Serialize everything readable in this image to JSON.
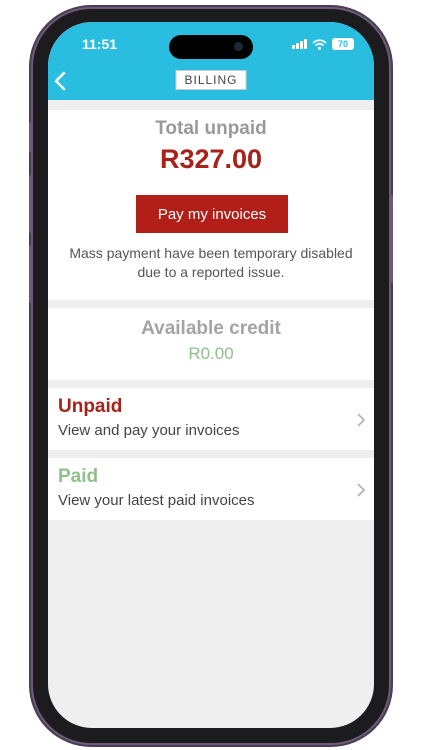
{
  "status_bar": {
    "time": "11:51",
    "battery": "70"
  },
  "header": {
    "title": "BILLING"
  },
  "summary": {
    "total_label": "Total unpaid",
    "total_amount": "R327.00",
    "pay_button": "Pay my invoices",
    "notice": "Mass payment have been temporary disabled due to a reported issue."
  },
  "credit": {
    "label": "Available credit",
    "amount": "R0.00"
  },
  "rows": [
    {
      "title": "Unpaid",
      "subtitle": "View and pay your invoices",
      "color": "#a72319"
    },
    {
      "title": "Paid",
      "subtitle": "View your latest paid invoices",
      "color": "#8fbf8a"
    }
  ],
  "colors": {
    "header_bg": "#29bedf",
    "accent_red": "#b21f19",
    "paid_green": "#8fbf8a"
  }
}
